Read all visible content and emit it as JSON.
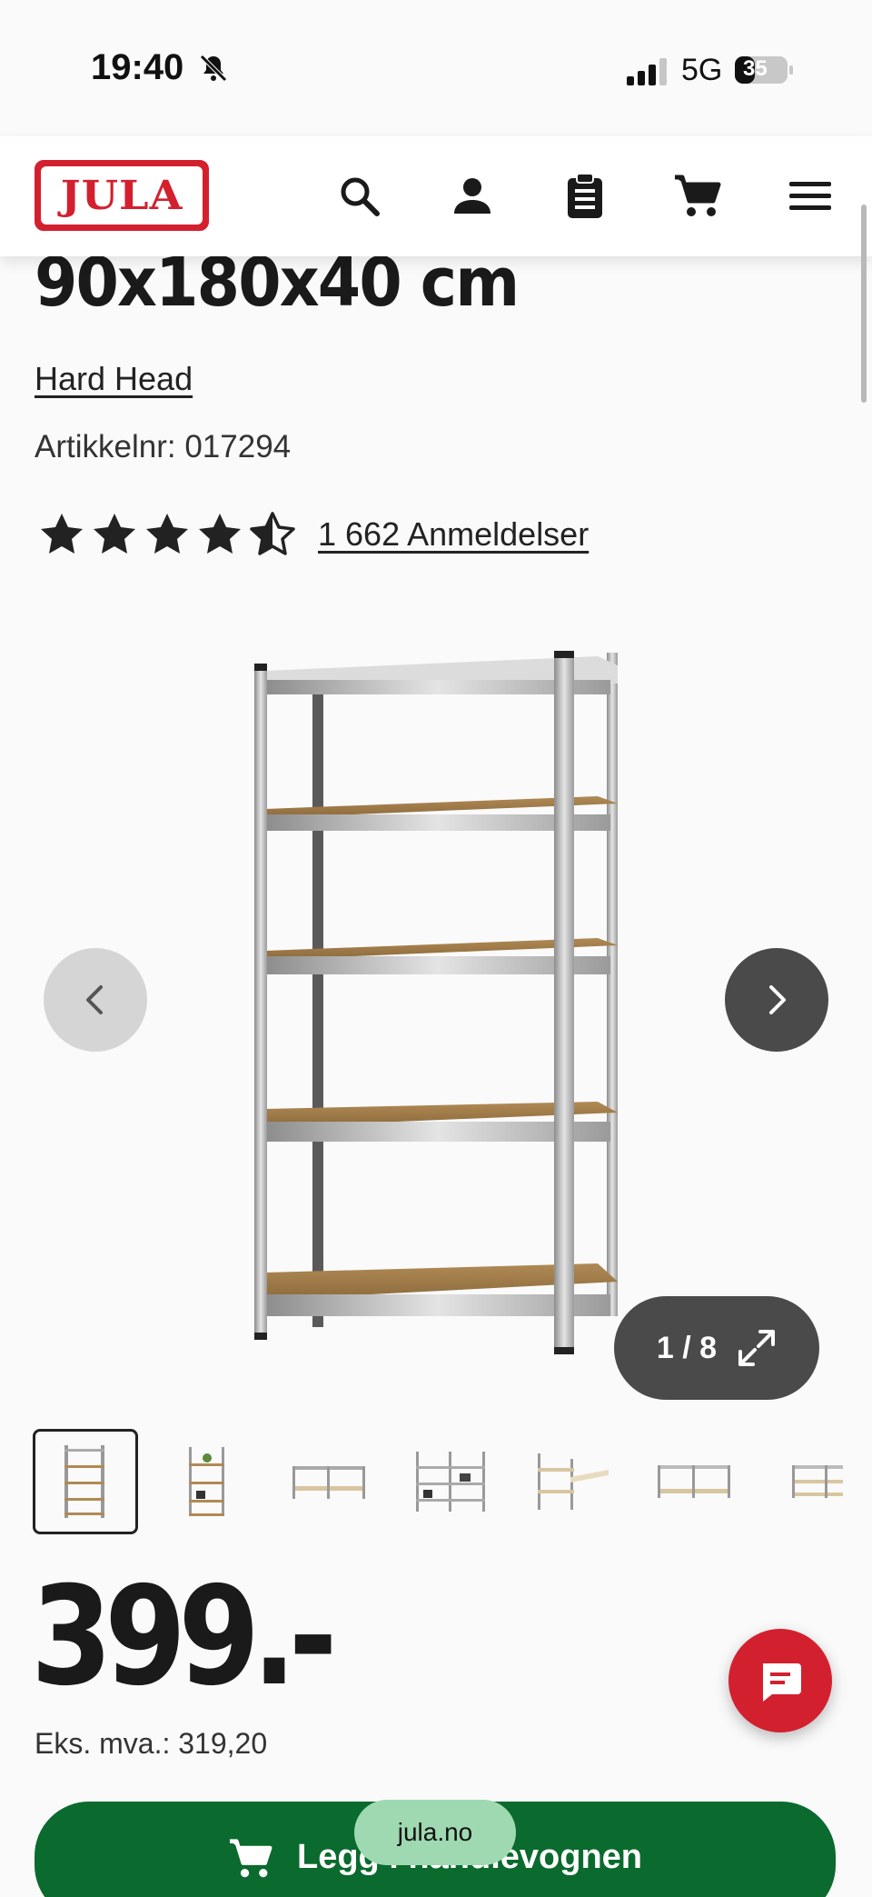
{
  "status_bar": {
    "time": "19:40",
    "network": "5G",
    "battery": "35"
  },
  "header": {
    "logo_text": "JULA"
  },
  "product": {
    "title": "90x180x40 cm",
    "brand": "Hard Head",
    "article_label": "Artikkelnr:",
    "article_number": "017294",
    "rating": 4.5,
    "reviews": "1 662 Anmeldelser"
  },
  "gallery": {
    "counter": "1 / 8",
    "current": 1,
    "total": 8
  },
  "price": {
    "amount": "399.-",
    "ex_vat": "Eks. mva.: 319,20"
  },
  "cart": {
    "label": "Legg i handlevognen"
  },
  "browser": {
    "url": "jula.no"
  },
  "colors": {
    "brand_red": "#d3202f",
    "cart_green": "#0b6a2e",
    "dark_button": "#4a4a4a"
  }
}
